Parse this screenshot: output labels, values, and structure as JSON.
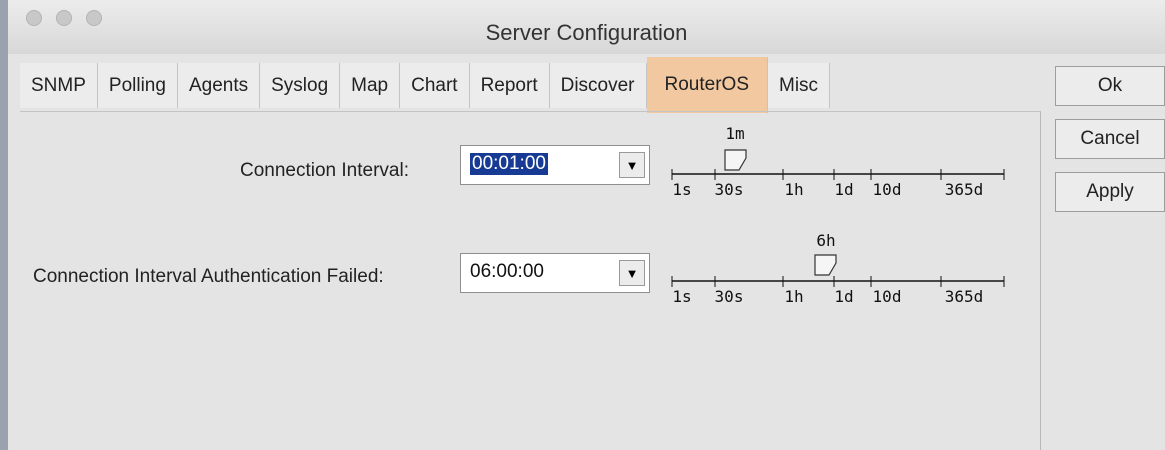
{
  "window": {
    "title": "Server Configuration"
  },
  "tabs": [
    "SNMP",
    "Polling",
    "Agents",
    "Syslog",
    "Map",
    "Chart",
    "Report",
    "Discover",
    "RouterOS",
    "Misc"
  ],
  "active_tab": "RouterOS",
  "buttons": {
    "ok": "Ok",
    "cancel": "Cancel",
    "apply": "Apply"
  },
  "settings": [
    {
      "label": "Connection Interval:",
      "value": "00:01:00",
      "value_selected": true,
      "slider": {
        "value_label": "1m",
        "ticks": [
          "1s",
          "30s",
          "1h",
          "1d",
          "10d",
          "365d"
        ]
      }
    },
    {
      "label": "Connection Interval Authentication Failed:",
      "value": "06:00:00",
      "value_selected": false,
      "slider": {
        "value_label": "6h",
        "ticks": [
          "1s",
          "30s",
          "1h",
          "1d",
          "10d",
          "365d"
        ]
      }
    }
  ]
}
